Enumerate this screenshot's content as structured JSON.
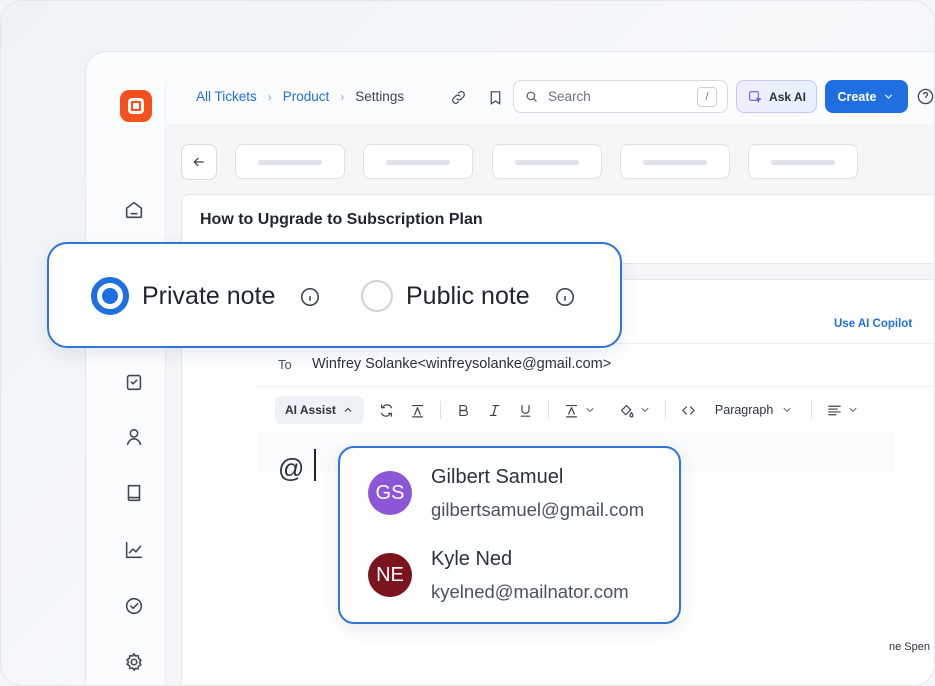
{
  "breadcrumb": {
    "items": [
      "All Tickets",
      "Product",
      "Settings"
    ]
  },
  "search": {
    "placeholder": "Search",
    "shortcut": "/"
  },
  "header": {
    "ask_ai_label": "Ask AI",
    "create_label": "Create"
  },
  "ticket": {
    "title": "How to Upgrade to Subscription Plan"
  },
  "note_type": {
    "options": [
      {
        "label": "Private note",
        "selected": true
      },
      {
        "label": "Public note",
        "selected": false
      }
    ]
  },
  "composer": {
    "copilot_label": "Use AI Copilot",
    "to_label": "To",
    "to_value": "Winfrey Solanke<winfreysolanke@gmail.com>",
    "toolbar": {
      "ai_assist_label": "AI Assist",
      "paragraph_label": "Paragraph"
    },
    "editor_text": "@",
    "partial_text": "ne Spen"
  },
  "mentions": [
    {
      "initials": "GS",
      "name": "Gilbert Samuel",
      "email": "gilbertsamuel@gmail.com",
      "color": "#8b57d6"
    },
    {
      "initials": "NE",
      "name": "Kyle Ned",
      "email": "kyelned@mailnator.com",
      "color": "#7c1420"
    }
  ],
  "colors": {
    "accent": "#1f6fe0",
    "brand": "#f4511e"
  },
  "sidebar": {
    "icons": [
      "home-icon",
      "ticket-icon",
      "task-icon",
      "contacts-icon",
      "knowledge-base-icon",
      "reports-icon",
      "approvals-icon",
      "settings-icon"
    ]
  }
}
